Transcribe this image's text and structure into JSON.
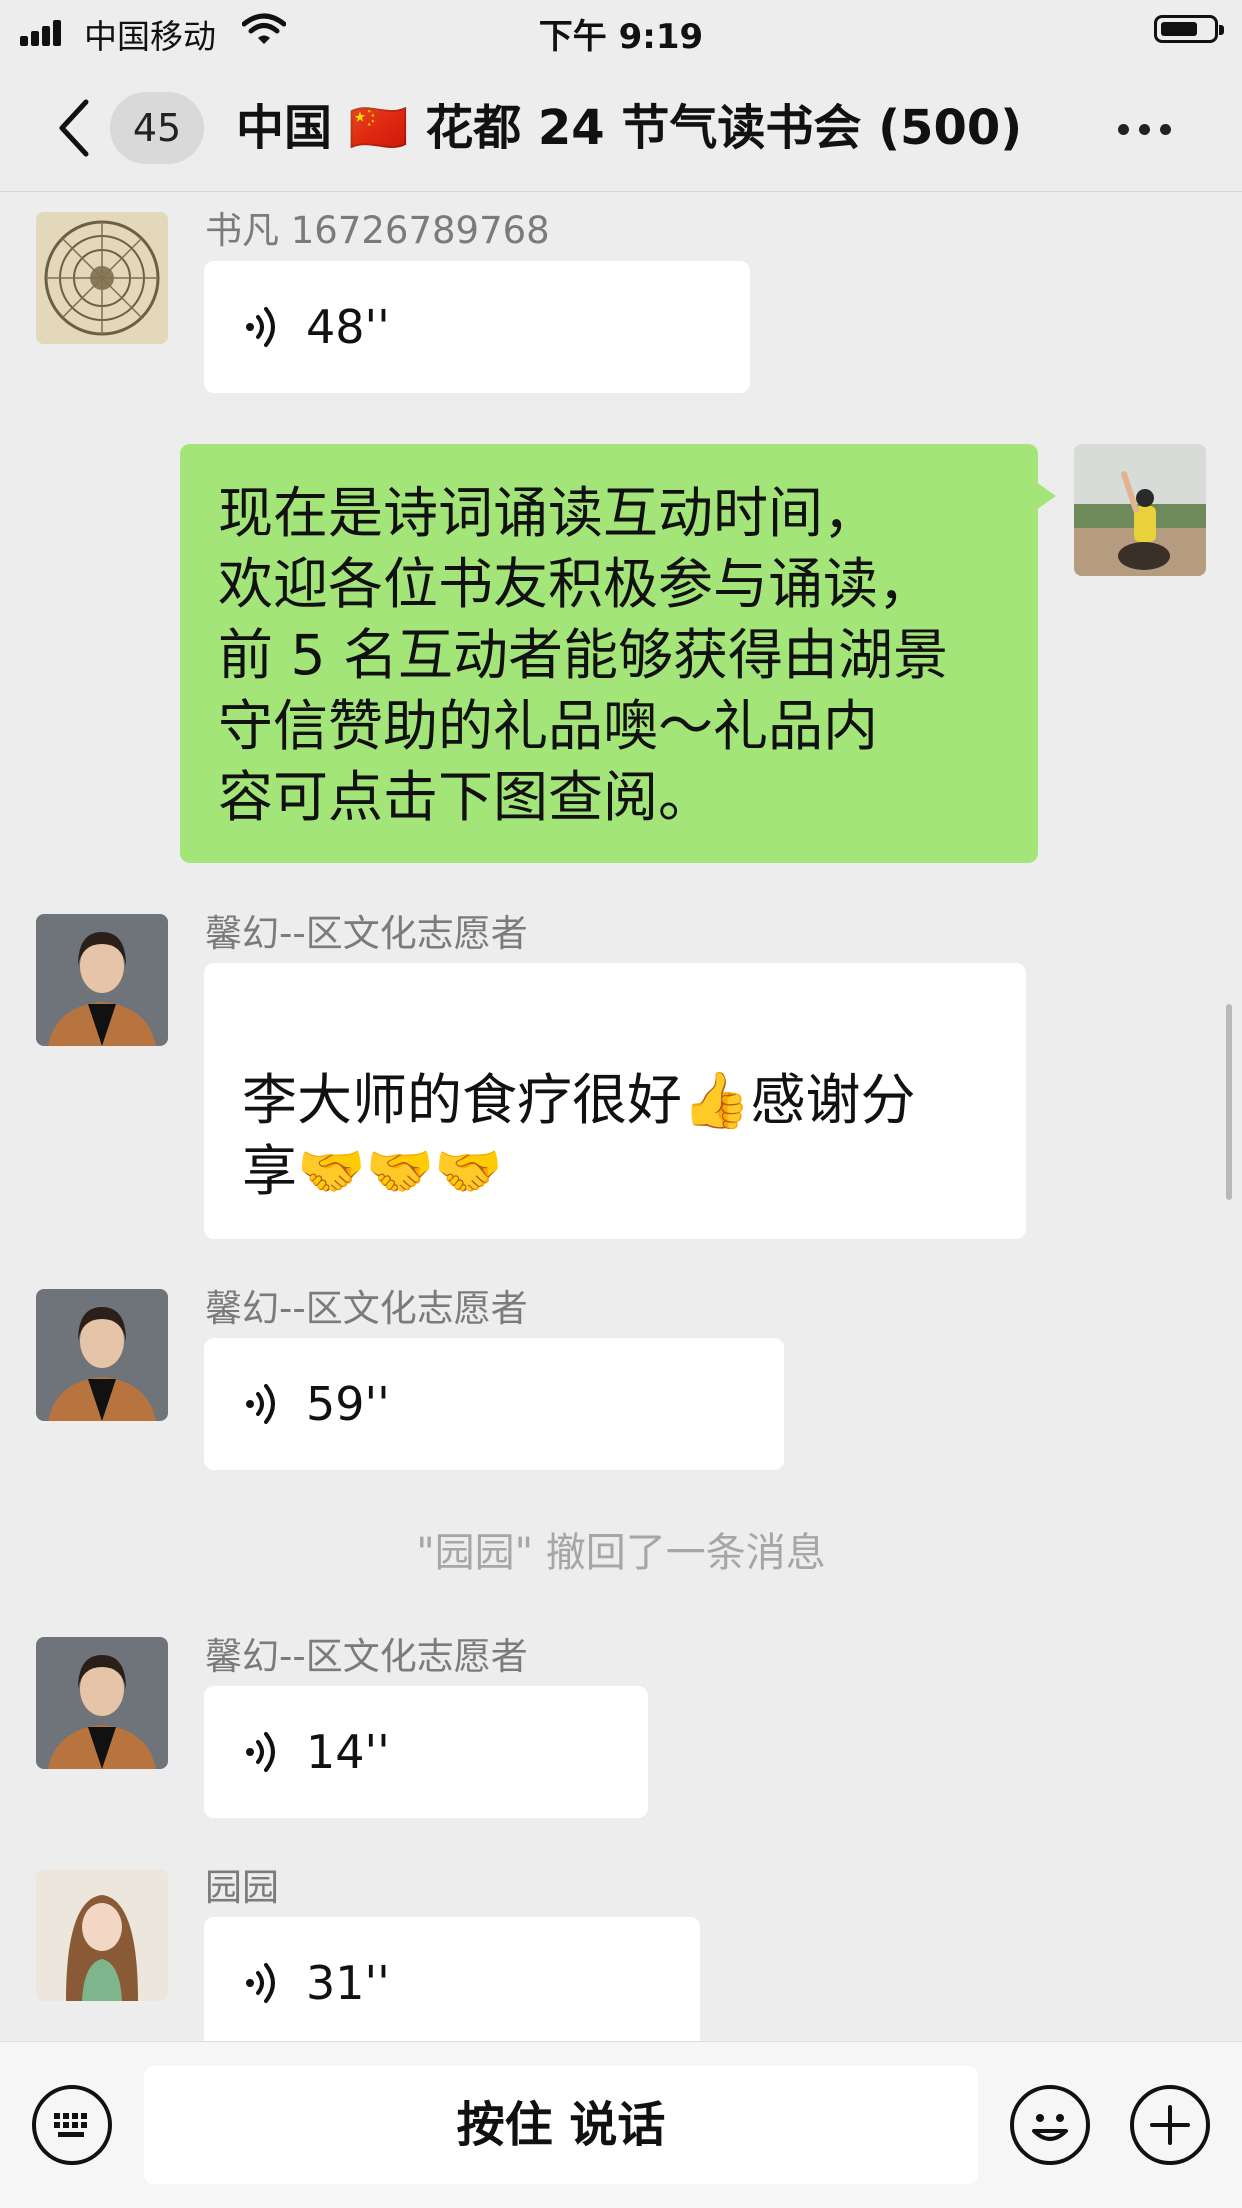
{
  "status_bar": {
    "carrier": "中国移动",
    "time": "下午 9:19"
  },
  "nav": {
    "unread_count": "45",
    "title": "中国 🇨🇳 花都 24 节气读书会 (500)"
  },
  "messages": [
    {
      "sender": "书凡 16726789768",
      "type": "voice",
      "duration": "48''"
    },
    {
      "sender": "",
      "type": "text",
      "self": true,
      "lines": [
        "现在是诗词诵读互动时间，",
        "欢迎各位书友积极参与诵读，",
        "前 5 名互动者能够获得由湖景",
        "守信赞助的礼品噢～礼品内",
        "容可点击下图查阅。"
      ]
    },
    {
      "sender": "馨幻--区文化志愿者",
      "type": "text",
      "lines": [
        "李大师的食疗很好👍感谢分",
        "享🤝🤝🤝"
      ]
    },
    {
      "sender": "馨幻--区文化志愿者",
      "type": "voice",
      "duration": "59''"
    },
    {
      "type": "system",
      "text": "\"园园\" 撤回了一条消息"
    },
    {
      "sender": "馨幻--区文化志愿者",
      "type": "voice",
      "duration": "14''"
    },
    {
      "sender": "园园",
      "type": "voice",
      "duration": "31''"
    }
  ],
  "input_bar": {
    "hold_to_talk": "按住 说话",
    "icons": [
      "keyboard-icon",
      "emoji-icon",
      "plus-icon"
    ]
  },
  "colors": {
    "background": "#ededed",
    "self_bubble": "#a4e57a",
    "other_bubble": "#ffffff"
  }
}
